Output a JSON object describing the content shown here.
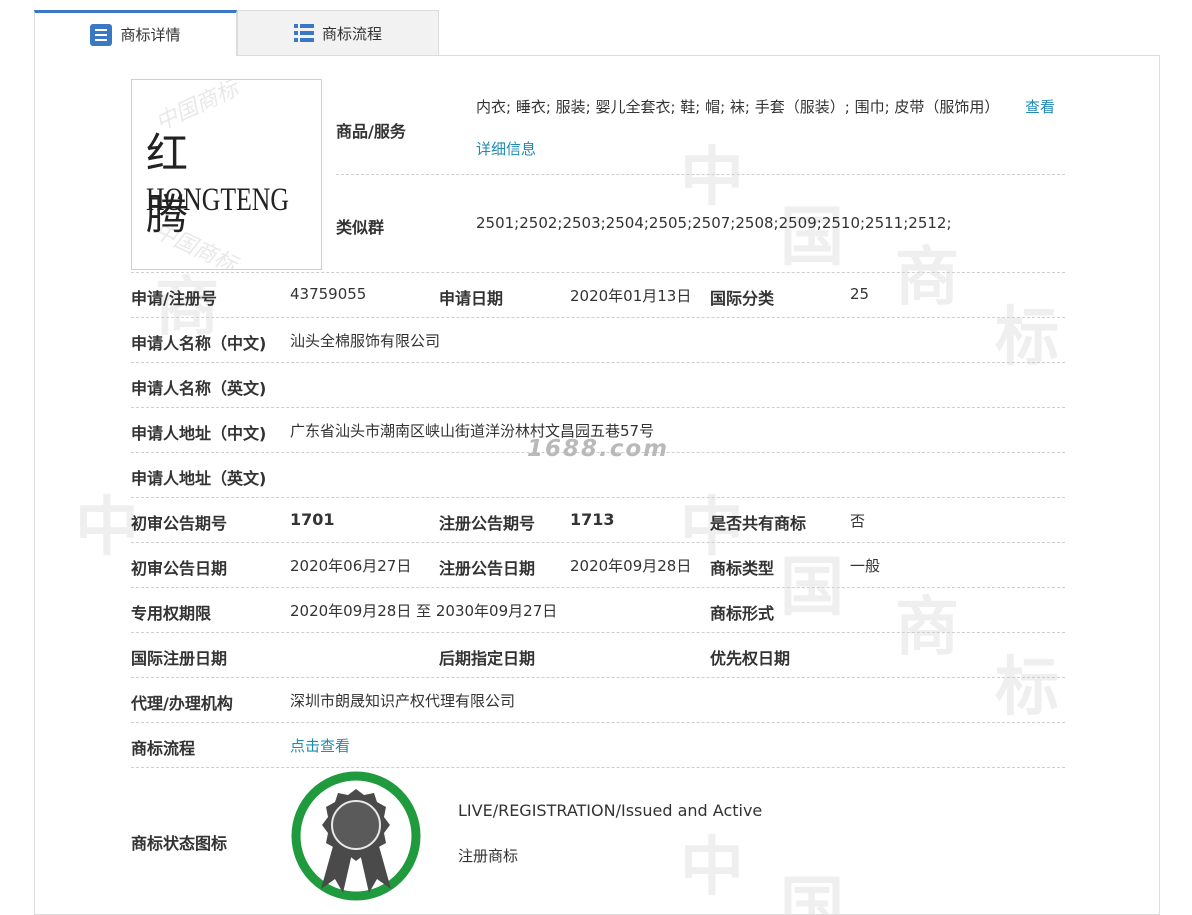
{
  "tabs": {
    "detail": "商标详情",
    "process": "商标流程"
  },
  "logo": {
    "text_cn": "红 腾",
    "text_en": "HONGTENG"
  },
  "goods": {
    "label": "商品/服务",
    "value": "内衣; 睡衣; 服装; 婴儿全套衣; 鞋; 帽; 袜; 手套（服装）; 围巾; 皮带（服饰用）",
    "link1": "查看",
    "link2": "详细信息"
  },
  "similar": {
    "label": "类似群",
    "value": "2501;2502;2503;2504;2505;2507;2508;2509;2510;2511;2512;"
  },
  "reg_no": {
    "label": "申请/注册号",
    "value": "43759055"
  },
  "apply_date": {
    "label": "申请日期",
    "value": "2020年01月13日"
  },
  "intl_class": {
    "label": "国际分类",
    "value": "25"
  },
  "applicant_cn": {
    "label": "申请人名称（中文)",
    "value": "汕头全棉服饰有限公司"
  },
  "applicant_en": {
    "label": "申请人名称（英文)",
    "value": ""
  },
  "address_cn": {
    "label": "申请人地址（中文)",
    "value": "广东省汕头市潮南区峡山街道洋汾林村文昌园五巷57号"
  },
  "address_en": {
    "label": "申请人地址（英文)",
    "value": ""
  },
  "prelim_no": {
    "label": "初审公告期号",
    "value": "1701"
  },
  "reg_pub_no": {
    "label": "注册公告期号",
    "value": "1713"
  },
  "shared": {
    "label": "是否共有商标",
    "value": "否"
  },
  "prelim_date": {
    "label": "初审公告日期",
    "value": "2020年06月27日"
  },
  "reg_pub_date": {
    "label": "注册公告日期",
    "value": "2020年09月28日"
  },
  "mark_type": {
    "label": "商标类型",
    "value": "一般"
  },
  "validity": {
    "label": "专用权期限",
    "value": "2020年09月28日 至 2030年09月27日"
  },
  "mark_form": {
    "label": "商标形式",
    "value": ""
  },
  "intl_reg_date": {
    "label": "国际注册日期",
    "value": ""
  },
  "later_date": {
    "label": "后期指定日期",
    "value": ""
  },
  "priority_date": {
    "label": "优先权日期",
    "value": ""
  },
  "agency": {
    "label": "代理/办理机构",
    "value": "深圳市朗晟知识产权代理有限公司"
  },
  "process": {
    "label": "商标流程",
    "value": "点击查看"
  },
  "status": {
    "label": "商标状态图标",
    "value_en": "LIVE/REGISTRATION/Issued and Active",
    "value_cn": "注册商标"
  },
  "site_watermark": "1688.com",
  "colors": {
    "accent": "#3a78c3",
    "link": "#1e8bb3",
    "badge_green": "#1f9a3c",
    "badge_dark": "#4a4a4a"
  }
}
